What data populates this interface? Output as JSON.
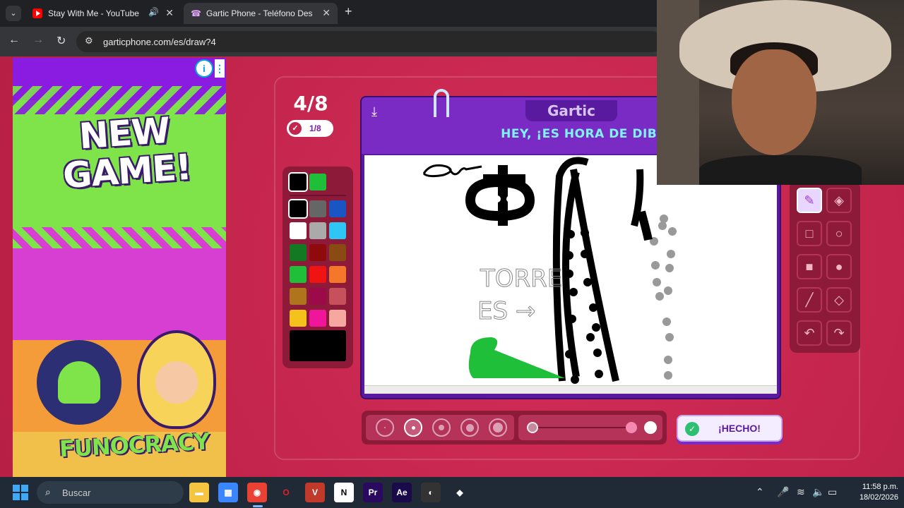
{
  "browser": {
    "tabs": [
      {
        "title": "Stay With Me - YouTube",
        "favicon": "youtube-icon",
        "audio": true
      },
      {
        "title": "Gartic Phone - Teléfono Descon",
        "favicon": "gartic-phone-icon",
        "active": true
      }
    ],
    "url": "garticphone.com/es/draw?4"
  },
  "ad": {
    "headline": "NEW GAME!",
    "brand": "FUNOCRACY"
  },
  "game": {
    "round": "4/8",
    "done_count": "1/8",
    "logo": "Gartic",
    "banner": "HEY, ¡ES HORA DE DIBUJAR!",
    "done_button": "¡HECHO!",
    "palette": {
      "current": [
        "#000000",
        "#1fbf3a"
      ],
      "colors": [
        "#000000",
        "#666666",
        "#1a55c4",
        "#ffffff",
        "#aaaaaa",
        "#2ec7f5",
        "#137a23",
        "#8f0b0b",
        "#8a4a14",
        "#1fbf3a",
        "#f01313",
        "#f5782a",
        "#b0741c",
        "#9c0a4a",
        "#c6505b",
        "#f5c21c",
        "#f0169b",
        "#f5a8a0"
      ],
      "selected_swatch": "#000000"
    },
    "tools": [
      "pencil-icon",
      "eraser-icon",
      "rectangle-outline-icon",
      "ellipse-outline-icon",
      "rectangle-fill-icon",
      "ellipse-fill-icon",
      "line-icon",
      "fill-bucket-icon",
      "undo-icon",
      "redo-icon"
    ],
    "active_tool": "pencil-icon",
    "brush_sizes": 5,
    "selected_brush_size_index": 1,
    "drawing_text": [
      "Qu",
      "TORRE",
      "ES →"
    ],
    "accent": "#7a2bc4"
  },
  "taskbar": {
    "search_placeholder": "Buscar",
    "apps": [
      "file-explorer-icon",
      "store-icon",
      "chrome-icon",
      "opera-icon",
      "voicemeeter-icon",
      "notion-icon",
      "premiere-icon",
      "after-effects-icon",
      "obs-icon",
      "app-icon"
    ],
    "time": "11:58 p.m.",
    "date": "18/02/2026"
  }
}
